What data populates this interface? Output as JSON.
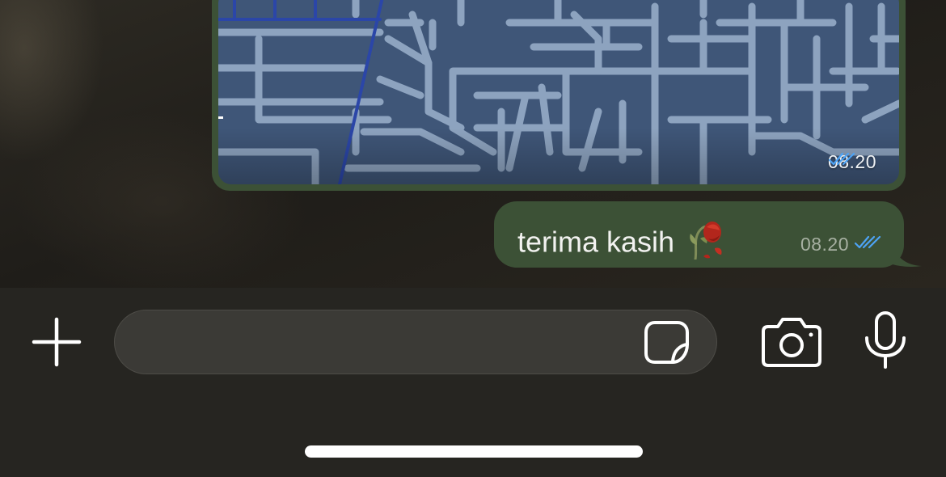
{
  "chat": {
    "map_message": {
      "time": "08.20",
      "read_status_icon": "double-check-icon"
    },
    "text_message": {
      "text": "terima kasih",
      "emoji": "wilted-flower-emoji",
      "time": "08.20",
      "read_status_icon": "double-check-icon"
    }
  },
  "composer": {
    "input_value": "",
    "icons": {
      "attach": "plus-icon",
      "sticker": "sticker-icon",
      "camera": "camera-icon",
      "voice": "microphone-icon"
    }
  },
  "colors": {
    "outgoing_bubble": "#3c5136",
    "read_ticks": "#4da3f5",
    "map_background": "#3f5678",
    "map_roads": "#8da3bf",
    "map_highlight_road": "#2b46a8",
    "composer_background": "#262521",
    "input_background": "#3b3a36"
  }
}
